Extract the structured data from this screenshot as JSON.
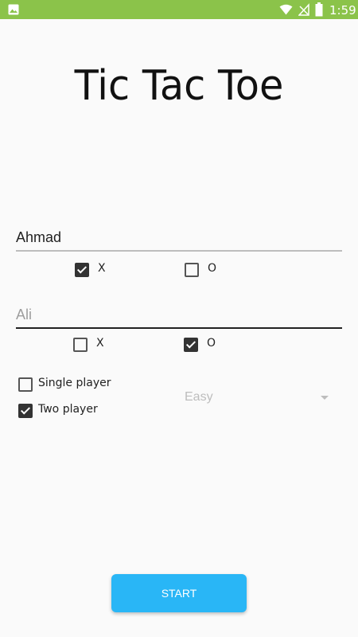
{
  "status_bar": {
    "time": "1:59",
    "icons": [
      "image-icon",
      "wifi-icon",
      "signal-icon",
      "battery-icon"
    ],
    "background": "#8bc34a"
  },
  "title": "Tic Tac Toe",
  "player1": {
    "name": "Ahmad",
    "x_label": "X",
    "o_label": "O",
    "x_checked": true,
    "o_checked": false
  },
  "player2": {
    "name": "Ali",
    "x_label": "X",
    "o_label": "O",
    "x_checked": false,
    "o_checked": true
  },
  "mode": {
    "single_label": "Single player",
    "two_label": "Two player",
    "single_checked": false,
    "two_checked": true
  },
  "difficulty": {
    "selected": "Easy"
  },
  "start_button": {
    "label": "START",
    "color": "#29b6f6"
  }
}
